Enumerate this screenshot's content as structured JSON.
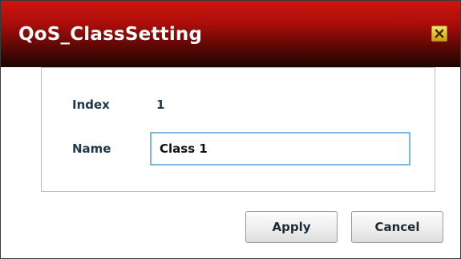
{
  "dialog": {
    "title": "QoS_ClassSetting",
    "close_icon": "close-icon",
    "accent_color": "#b1100b"
  },
  "form": {
    "index_label": "Index",
    "index_value": "1",
    "name_label": "Name",
    "name_value": "Class 1"
  },
  "buttons": {
    "apply_label": "Apply",
    "cancel_label": "Cancel"
  }
}
